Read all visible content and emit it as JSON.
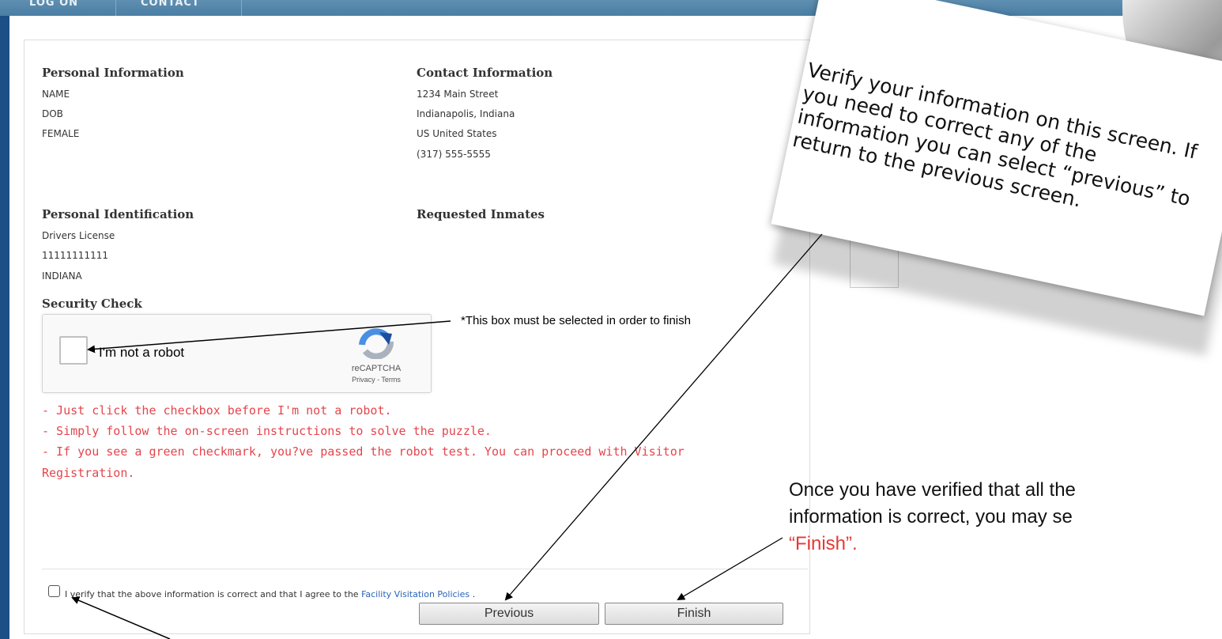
{
  "nav": {
    "items": [
      "LOG ON",
      "CONTACT"
    ]
  },
  "personal_info": {
    "heading": "Personal Information",
    "lines": [
      "NAME",
      "DOB",
      "FEMALE"
    ]
  },
  "contact_info": {
    "heading": "Contact Information",
    "lines": [
      "1234 Main Street",
      "Indianapolis, Indiana",
      "US United States",
      "(317) 555-5555"
    ]
  },
  "personal_id": {
    "heading": "Personal Identification",
    "lines": [
      "Drivers License",
      "11111111111",
      "INDIANA"
    ]
  },
  "requested_inmates": {
    "heading": "Requested Inmates"
  },
  "security": {
    "heading": "Security Check",
    "captcha_label": "I'm not a robot",
    "captcha_brand": "reCAPTCHA",
    "captcha_links": "Privacy - Terms",
    "instructions": [
      "- Just click the checkbox before I'm not a robot.",
      "- Simply follow the on-screen instructions to solve the puzzle.",
      "- If you see a green checkmark, you?ve passed the robot test. You can proceed with Visitor",
      "Registration."
    ]
  },
  "verify": {
    "text": "I verify that the above information is correct and that I agree to the",
    "link": "Facility Visitation Policies",
    "end": " ."
  },
  "buttons": {
    "previous": "Previous",
    "finish": "Finish"
  },
  "annotations": {
    "captcha_note": "*This box must be selected in order to finish",
    "note_text": "Verify your information on this screen. If you need to correct any of the information you can select “previous” to return to the previous screen.",
    "finish_note_line1": "Once you have verified that all the",
    "finish_note_line2": "information is correct, you may se",
    "finish_note_red": "“Finish”."
  }
}
